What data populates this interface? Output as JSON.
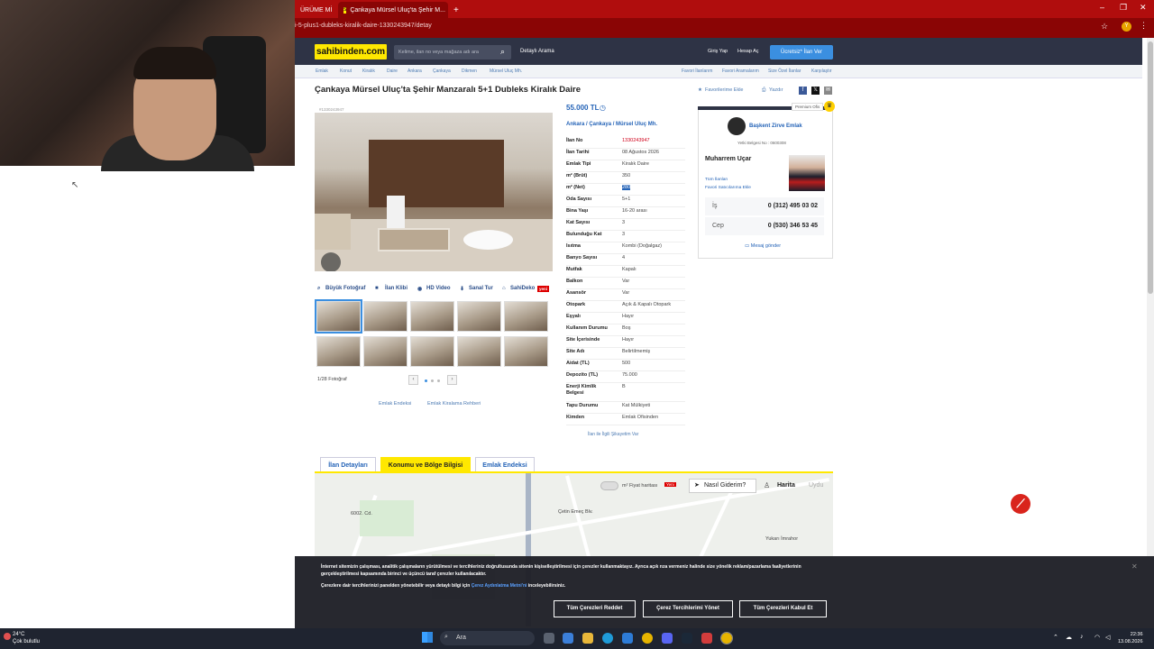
{
  "browser": {
    "tabs": [
      {
        "label": "ÜRÜME Mİ"
      },
      {
        "label": "Çankaya Mürsel Uluç'ta Şehir M..."
      }
    ],
    "url": "i-5-plus1-dubleks-kiralik-daire-1330243947/detay"
  },
  "header": {
    "logo": "sahibinden.com",
    "search_placeholder": "Kelime, ilan no veya mağaza adı ara",
    "detailed_search": "Detaylı Arama",
    "login": "Giriş Yap",
    "register": "Hesap Aç",
    "post_ad": "Ücretsiz* İlan Ver"
  },
  "breadcrumb": [
    "Emlak",
    "Konut",
    "Kiralık",
    "Daire",
    "Ankara",
    "Çankaya",
    "Dikmen",
    "Mürsel Uluç Mh."
  ],
  "top_links": [
    "Favori İlanlarım",
    "Favori Aramalarım",
    "Size Özel İlanlar",
    "Karşılaştır"
  ],
  "listing": {
    "title": "Çankaya Mürsel Uluç'ta Şehir Manzaralı 5+1 Dubleks Kiralık Daire",
    "favorite": "Favorilerime Ekle",
    "print": "Yazdır",
    "id_small": "#1330243947",
    "price": "55.000 TL",
    "location": "Ankara  /  Çankaya  /  Mürsel Uluç Mh.",
    "details": [
      {
        "k": "İlan No",
        "v": "1330243947"
      },
      {
        "k": "İlan Tarihi",
        "v": "08 Ağustos 2026"
      },
      {
        "k": "Emlak Tipi",
        "v": "Kiralık Daire"
      },
      {
        "k": "m² (Brüt)",
        "v": "350"
      },
      {
        "k": "m² (Net)",
        "v": "280"
      },
      {
        "k": "Oda Sayısı",
        "v": "5+1"
      },
      {
        "k": "Bina Yaşı",
        "v": "16-20 arası"
      },
      {
        "k": "Kat Sayısı",
        "v": "3"
      },
      {
        "k": "Bulunduğu Kat",
        "v": "3"
      },
      {
        "k": "Isıtma",
        "v": "Kombi (Doğalgaz)"
      },
      {
        "k": "Banyo Sayısı",
        "v": "4"
      },
      {
        "k": "Mutfak",
        "v": "Kapalı"
      },
      {
        "k": "Balkon",
        "v": "Var"
      },
      {
        "k": "Asansör",
        "v": "Var"
      },
      {
        "k": "Otopark",
        "v": "Açık & Kapalı Otopark"
      },
      {
        "k": "Eşyalı",
        "v": "Hayır"
      },
      {
        "k": "Kullanım Durumu",
        "v": "Boş"
      },
      {
        "k": "Site İçerisinde",
        "v": "Hayır"
      },
      {
        "k": "Site Adı",
        "v": "Belirtilmemiş"
      },
      {
        "k": "Aidat (TL)",
        "v": "500"
      },
      {
        "k": "Depozito (TL)",
        "v": "75.000"
      },
      {
        "k": "Enerji Kimlik Belgesi",
        "v": "B"
      },
      {
        "k": "Tapu Durumu",
        "v": "Kat Mülkiyeti"
      },
      {
        "k": "Kimden",
        "v": "Emlak Ofisinden"
      }
    ],
    "report": "İlan ile İlgili Şikayetim Var"
  },
  "media": {
    "big_photo": "Büyük Fotoğraf",
    "video": "İlan Klibi",
    "hd": "HD Video",
    "virtual": "Sanal Tur",
    "sahideko": "SahiDeko",
    "new_badge": "yeni",
    "count": "1/28 Fotoğraf"
  },
  "bottom_links": [
    "Emlak Endeksi",
    "Emlak Kiralama Rehberi"
  ],
  "agent": {
    "premium": "Premium Ofis",
    "office": "Başkent Zirve Emlak",
    "license": "Yetki Belgesi No : 0600308",
    "name": "Muharrem Uçar",
    "all_ads": "Tüm İlanları",
    "fav_seller": "Favori Satıcılarıma Ekle",
    "phones": [
      {
        "label": "İş",
        "number": "0 (312) 495 03 02"
      },
      {
        "label": "Cep",
        "number": "0 (530) 346 53 45"
      }
    ],
    "message": "Mesaj gönder"
  },
  "tabs": [
    {
      "label": "İlan Detayları"
    },
    {
      "label": "Konumu ve Bölge Bilgisi"
    },
    {
      "label": "Emlak Endeksi"
    }
  ],
  "map": {
    "price_map": "m² Fiyat haritası",
    "new_badge": "Yeni",
    "how": "Nasıl Giderim?",
    "map_btn": "Harita",
    "sat_btn": "Uydu",
    "labels": [
      "6002. Cd.",
      "Çetin Emeç Blv.",
      "Yukarı İmrahor"
    ]
  },
  "cookie": {
    "text1": "İnternet sitemizin çalışması, analitik çalışmaların yürütülmesi ve tercihleriniz doğrultusunda sitenin kişiselleştirilmesi için çerezler kullanmaktayız. Ayrıca açık rıza vermeniz halinde size yönelik reklam/pazarlama faaliyetlerinin gerçekleştirilmesi kapsamında birinci ve üçüncü taraf çerezler kullanılacaktır.",
    "text2_pre": "Çerezlere dair tercihlerinizi panelden yönetebilir veya detaylı bilgi için ",
    "text2_link": "Çerez Aydınlatma Metni'ni",
    "text2_post": " inceleyebilirsiniz.",
    "reject": "Tüm Çerezleri Reddet",
    "manage": "Çerez Tercihlerimi Yönet",
    "accept": "Tüm Çerezleri Kabul Et"
  },
  "taskbar": {
    "temp": "24°C",
    "weather": "Çok bulutlu",
    "search": "Ara",
    "time": "22:36",
    "date": "13.08.2026"
  }
}
